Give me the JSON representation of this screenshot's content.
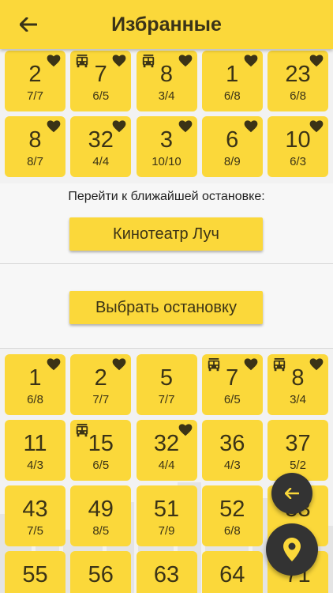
{
  "header": {
    "title": "Избранные"
  },
  "colors": {
    "accent": "#fbd83a",
    "text": "#3b3316",
    "fab": "#333333"
  },
  "favorites": [
    {
      "num": "2",
      "sub": "7/7",
      "heart": true,
      "bus": false
    },
    {
      "num": "7",
      "sub": "6/5",
      "heart": true,
      "bus": true
    },
    {
      "num": "8",
      "sub": "3/4",
      "heart": true,
      "bus": true
    },
    {
      "num": "1",
      "sub": "6/8",
      "heart": true,
      "bus": false
    },
    {
      "num": "23",
      "sub": "6/8",
      "heart": true,
      "bus": false
    },
    {
      "num": "8",
      "sub": "8/7",
      "heart": true,
      "bus": false
    },
    {
      "num": "32",
      "sub": "4/4",
      "heart": true,
      "bus": false
    },
    {
      "num": "3",
      "sub": "10/10",
      "heart": true,
      "bus": false
    },
    {
      "num": "6",
      "sub": "8/9",
      "heart": true,
      "bus": false
    },
    {
      "num": "10",
      "sub": "6/3",
      "heart": true,
      "bus": false
    }
  ],
  "nearest": {
    "label": "Перейти к ближайшей остановке:",
    "button": "Кинотеатр Луч"
  },
  "choose": {
    "button": "Выбрать остановку"
  },
  "routes": [
    {
      "num": "1",
      "sub": "6/8",
      "heart": true,
      "bus": false
    },
    {
      "num": "2",
      "sub": "7/7",
      "heart": true,
      "bus": false
    },
    {
      "num": "5",
      "sub": "7/7",
      "heart": false,
      "bus": false
    },
    {
      "num": "7",
      "sub": "6/5",
      "heart": true,
      "bus": true
    },
    {
      "num": "8",
      "sub": "3/4",
      "heart": true,
      "bus": true
    },
    {
      "num": "11",
      "sub": "4/3",
      "heart": false,
      "bus": false
    },
    {
      "num": "15",
      "sub": "6/5",
      "heart": false,
      "bus": true
    },
    {
      "num": "32",
      "sub": "4/4",
      "heart": true,
      "bus": false
    },
    {
      "num": "36",
      "sub": "4/3",
      "heart": false,
      "bus": false
    },
    {
      "num": "37",
      "sub": "5/2",
      "heart": false,
      "bus": false
    },
    {
      "num": "43",
      "sub": "7/5",
      "heart": false,
      "bus": false
    },
    {
      "num": "49",
      "sub": "8/5",
      "heart": false,
      "bus": false
    },
    {
      "num": "51",
      "sub": "7/9",
      "heart": false,
      "bus": false
    },
    {
      "num": "52",
      "sub": "6/8",
      "heart": false,
      "bus": false
    },
    {
      "num": "53",
      "sub": "",
      "heart": false,
      "bus": false
    },
    {
      "num": "55",
      "sub": "",
      "heart": false,
      "bus": false
    },
    {
      "num": "56",
      "sub": "",
      "heart": false,
      "bus": false
    },
    {
      "num": "63",
      "sub": "",
      "heart": false,
      "bus": false
    },
    {
      "num": "64",
      "sub": "",
      "heart": false,
      "bus": false
    },
    {
      "num": "71",
      "sub": "",
      "heart": false,
      "bus": false
    }
  ],
  "fabs": {
    "small_icon": "arrow-left-icon",
    "large_icon": "location-pin-icon"
  }
}
